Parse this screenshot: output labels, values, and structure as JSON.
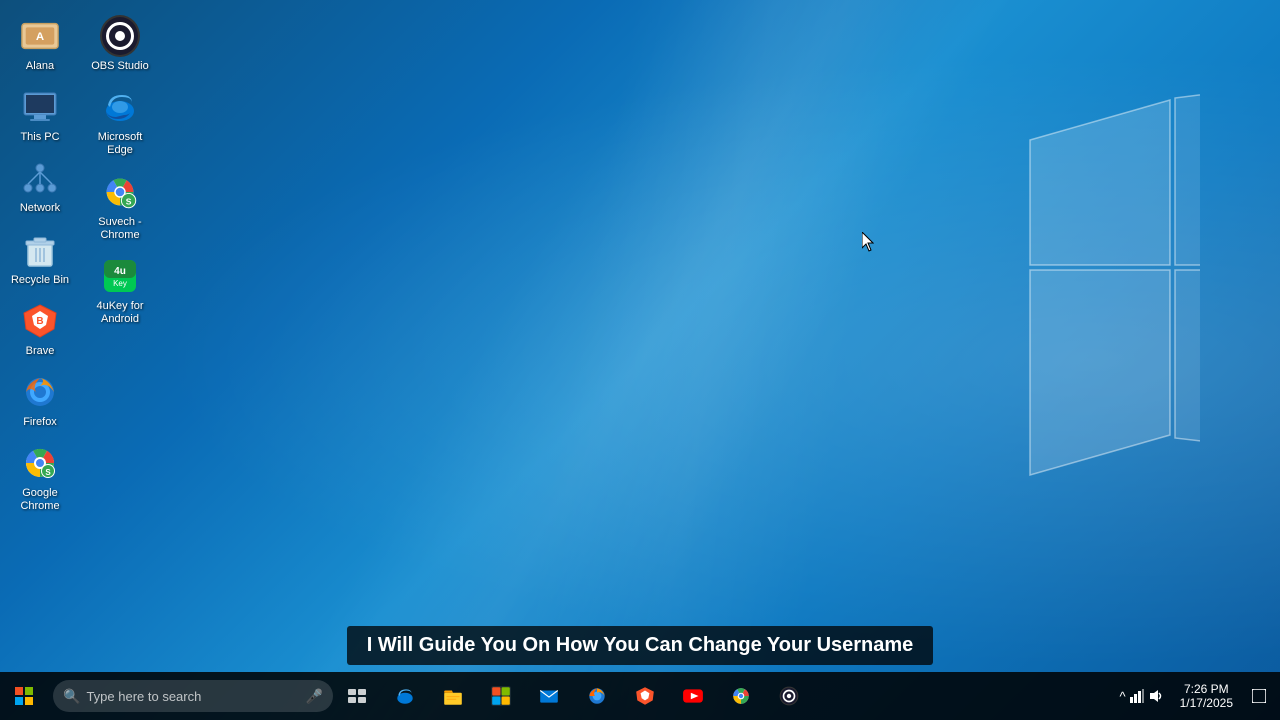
{
  "desktop": {
    "background": "Windows 10 blue desktop"
  },
  "icons": {
    "column1": [
      {
        "id": "alana",
        "label": "Alana",
        "type": "alana"
      },
      {
        "id": "this-pc",
        "label": "This PC",
        "type": "thispc"
      },
      {
        "id": "network",
        "label": "Network",
        "type": "network"
      },
      {
        "id": "recycle-bin",
        "label": "Recycle Bin",
        "type": "recyclebin"
      },
      {
        "id": "brave",
        "label": "Brave",
        "type": "brave"
      },
      {
        "id": "firefox",
        "label": "Firefox",
        "type": "firefox"
      },
      {
        "id": "google-chrome",
        "label": "Google Chrome",
        "type": "chrome"
      }
    ],
    "column2": [
      {
        "id": "obs-studio",
        "label": "OBS Studio",
        "type": "obs"
      },
      {
        "id": "microsoft-edge",
        "label": "Microsoft Edge",
        "type": "edge"
      },
      {
        "id": "suvech-chrome",
        "label": "Suvech - Chrome",
        "type": "suvech-chrome"
      },
      {
        "id": "4ukey-android",
        "label": "4uKey for Android",
        "type": "4ukey"
      }
    ]
  },
  "subtitle": {
    "text": "I Will Guide You On How You Can Change Your Username"
  },
  "taskbar": {
    "search_placeholder": "Type here to search",
    "clock_time": "7:26 PM",
    "clock_date": "1/17/2025",
    "apps": [
      {
        "id": "edge",
        "label": "Microsoft Edge"
      },
      {
        "id": "file-explorer",
        "label": "File Explorer"
      },
      {
        "id": "store",
        "label": "Microsoft Store"
      },
      {
        "id": "mail",
        "label": "Mail"
      },
      {
        "id": "firefox-tb",
        "label": "Firefox"
      },
      {
        "id": "brave-tb",
        "label": "Brave"
      },
      {
        "id": "youtube",
        "label": "YouTube"
      },
      {
        "id": "chrome-tb",
        "label": "Google Chrome"
      },
      {
        "id": "obs-tb",
        "label": "OBS Studio"
      }
    ]
  }
}
